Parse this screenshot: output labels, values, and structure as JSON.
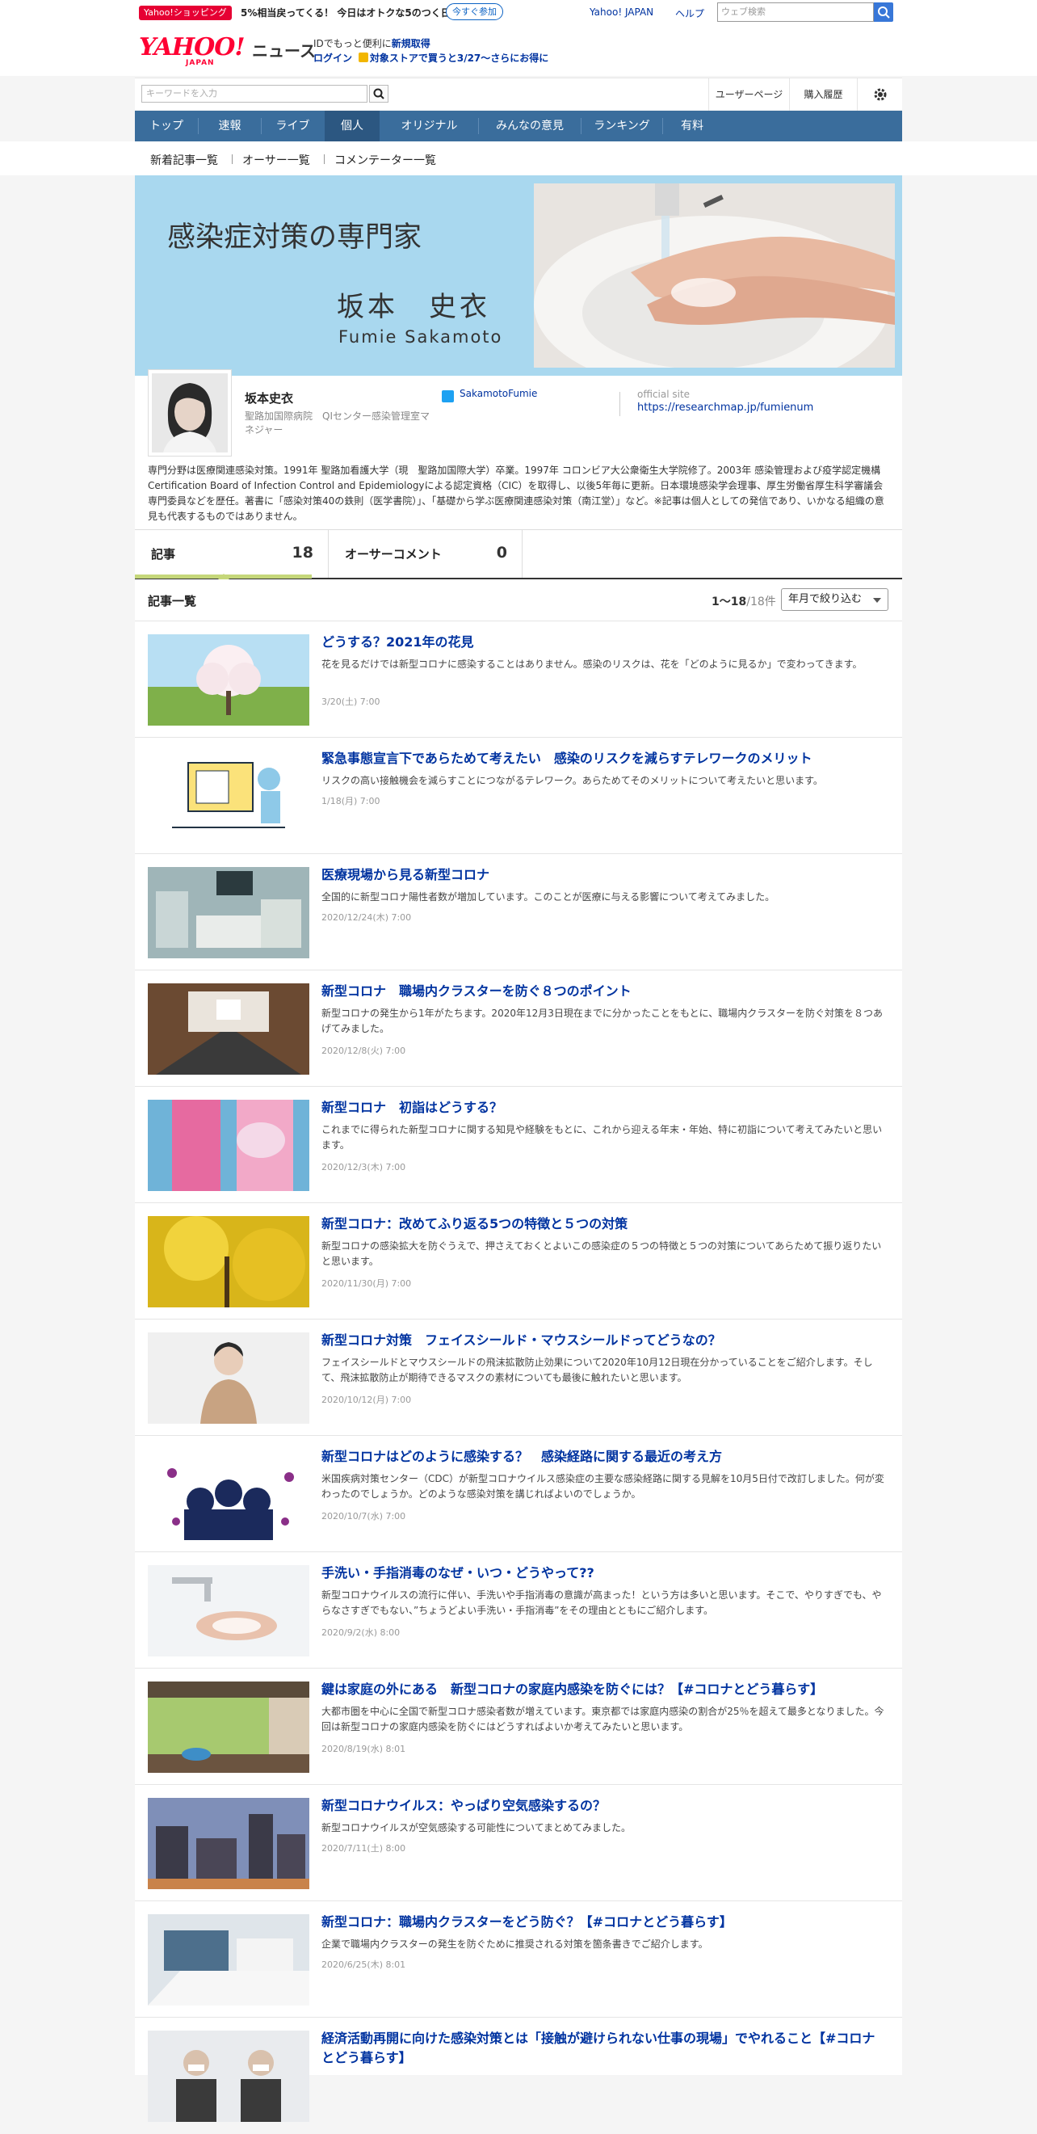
{
  "topbar": {
    "promo_badge": "Yahoo!ショッピング",
    "promo_text": "5%相当戻ってくる！ 今日はオトクな5のつく日",
    "promo_button": "今すぐ参加",
    "link_yahoo": "Yahoo! JAPAN",
    "link_help": "ヘルプ",
    "web_search_placeholder": "ウェブ検索"
  },
  "header": {
    "logo": "YAHOO!",
    "logo_sub": "JAPAN",
    "section": "ニュース",
    "login_prefix": "IDでもっと便利に",
    "signup": "新規取得",
    "login": "ログイン",
    "campaign": "対象ストアで買うと3/27～さらにお得に"
  },
  "search": {
    "placeholder": "キーワードを入力",
    "user_page": "ユーザーページ",
    "history": "購入履歴"
  },
  "nav": {
    "items": [
      "トップ",
      "速報",
      "ライブ",
      "個人",
      "オリジナル",
      "みんなの意見",
      "ランキング",
      "有料"
    ]
  },
  "subnav": {
    "items": [
      "新着記事一覧",
      "オーサー一覧",
      "コメンテーター一覧"
    ]
  },
  "banner": {
    "title": "感染症対策の専門家",
    "name": "坂本　史衣",
    "roman": "Fumie  Sakamoto"
  },
  "profile": {
    "name": "坂本史衣",
    "affiliation": "聖路加国際病院　QIセンター感染管理室マネジャー",
    "twitter": "SakamotoFumie",
    "official_label": "official site",
    "official_url": "https://researchmap.jp/fumienum",
    "bio": "専門分野は医療関連感染対策。1991年 聖路加看護大学（現　聖路加国際大学）卒業。1997年 コロンビア大公衆衛生大学院修了。2003年 感染管理および疫学認定機構Certification Board of Infection Control and Epidemiologyによる認定資格（CIC）を取得し、以後5年毎に更新。日本環境感染学会理事、厚生労働省厚生科学審議会専門委員などを歴任。著書に「感染対策40の鉄則（医学書院）」、「基礎から学ぶ医療関連感染対策（南江堂）」など。※記事は個人としての発信であり、いかなる組織の意見も代表するものではありません。"
  },
  "tabs": [
    {
      "label": "記事",
      "count": "18"
    },
    {
      "label": "オーサーコメント",
      "count": "0"
    }
  ],
  "list": {
    "title": "記事一覧",
    "range": "1～18",
    "total": "/18件",
    "filter": "年月で絞り込む"
  },
  "articles": [
    {
      "title": "どうする？2021年の花見",
      "desc": "花を見るだけでは新型コロナに感染することはありません。感染のリスクは、花を「どのように見るか」で変わってきます。",
      "date": "3/20(土) 7:00",
      "thumb": "cherry-blossom"
    },
    {
      "title": "緊急事態宣言下であらためて考えたい　感染のリスクを減らすテレワークのメリット",
      "desc": "リスクの高い接触機会を減らすことにつながるテレワーク。あらためてそのメリットについて考えたいと思います。",
      "date": "1/18(月) 7:00",
      "thumb": "telework-illustration"
    },
    {
      "title": "医療現場から見る新型コロナ",
      "desc": "全国的に新型コロナ陽性者数が増加しています。このことが医療に与える影響について考えてみました。",
      "date": "2020/12/24(木) 7:00",
      "thumb": "icu-room"
    },
    {
      "title": "新型コロナ　職場内クラスターを防ぐ８つのポイント",
      "desc": "新型コロナの発生から1年がたちます。2020年12月3日現在までに分かったことをもとに、職場内クラスターを防ぐ対策を８つあげてみました。",
      "date": "2020/12/8(火) 7:00",
      "thumb": "meeting-room"
    },
    {
      "title": "新型コロナ　初詣はどうする？",
      "desc": "これまでに得られた新型コロナに関する知見や経験をもとに、これから迎える年末・年始、特に初詣について考えてみたいと思います。",
      "date": "2020/12/3(木) 7:00",
      "thumb": "kimono"
    },
    {
      "title": "新型コロナ：改めてふり返る5つの特徴と５つの対策",
      "desc": "新型コロナの感染拡大を防ぐうえで、押さえておくとよいこの感染症の５つの特徴と５つの対策についてあらためて振り返りたいと思います。",
      "date": "2020/11/30(月) 7:00",
      "thumb": "ginkgo"
    },
    {
      "title": "新型コロナ対策　フェイスシールド・マウスシールドってどうなの？",
      "desc": "フェイスシールドとマウスシールドの飛沫拡散防止効果について2020年10月12日現在分かっていることをご紹介します。そして、飛沫拡散防止が期待できるマスクの素材についても最後に触れたいと思います。",
      "date": "2020/10/12(月) 7:00",
      "thumb": "face-shield"
    },
    {
      "title": "新型コロナはどのように感染する？　感染経路に関する最近の考え方",
      "desc": "米国疾病対策センター（CDC）が新型コロナウイルス感染症の主要な感染経路に関する見解を10月5日付で改訂しました。何が変わったのでしょうか。どのような感染対策を講じればよいのでしょうか。",
      "date": "2020/10/7(水) 7:00",
      "thumb": "virus-illustration"
    },
    {
      "title": "手洗い・手指消毒のなぜ・いつ・どうやって??",
      "desc": "新型コロナウイルスの流行に伴い、手洗いや手指消毒の意識が高まった！という方は多いと思います。そこで、やりすぎでも、やらなさすぎでもない、”ちょうどよい手洗い・手指消毒”をその理由とともにご紹介します。",
      "date": "2020/9/2(水) 8:00",
      "thumb": "hand-washing"
    },
    {
      "title": "鍵は家庭の外にある　新型コロナの家庭内感染を防ぐには？【#コロナとどう暮らす】",
      "desc": "大都市圏を中心に全国で新型コロナ感染者数が増えています。東京都では家庭内感染の割合が25％を超えて最多となりました。今回は新型コロナの家庭内感染を防ぐにはどうすればよいか考えてみたいと思います。",
      "date": "2020/8/19(水) 8:01",
      "thumb": "window-fan"
    },
    {
      "title": "新型コロナウイルス：やっぱり空気感染するの？",
      "desc": "新型コロナウイルスが空気感染する可能性についてまとめてみました。",
      "date": "2020/7/11(土) 8:00",
      "thumb": "night-city"
    },
    {
      "title": "新型コロナ：職場内クラスターをどう防ぐ？【#コロナとどう暮らす】",
      "desc": "企業で職場内クラスターの発生を防ぐために推奨される対策を箇条書きでご紹介します。",
      "date": "2020/6/25(木) 8:01",
      "thumb": "office-desk"
    },
    {
      "title": "経済活動再開に向けた感染対策とは「接触が避けられない仕事の現場」でやれること【#コロナとどう暮らす】",
      "desc": "",
      "date": "",
      "thumb": "masked-workers"
    }
  ],
  "colors": {
    "nav_bg": "#3a6d9c",
    "banner_bg": "#a9d8ef",
    "link": "#0033a0",
    "yahoo_red": "#ff0033"
  }
}
